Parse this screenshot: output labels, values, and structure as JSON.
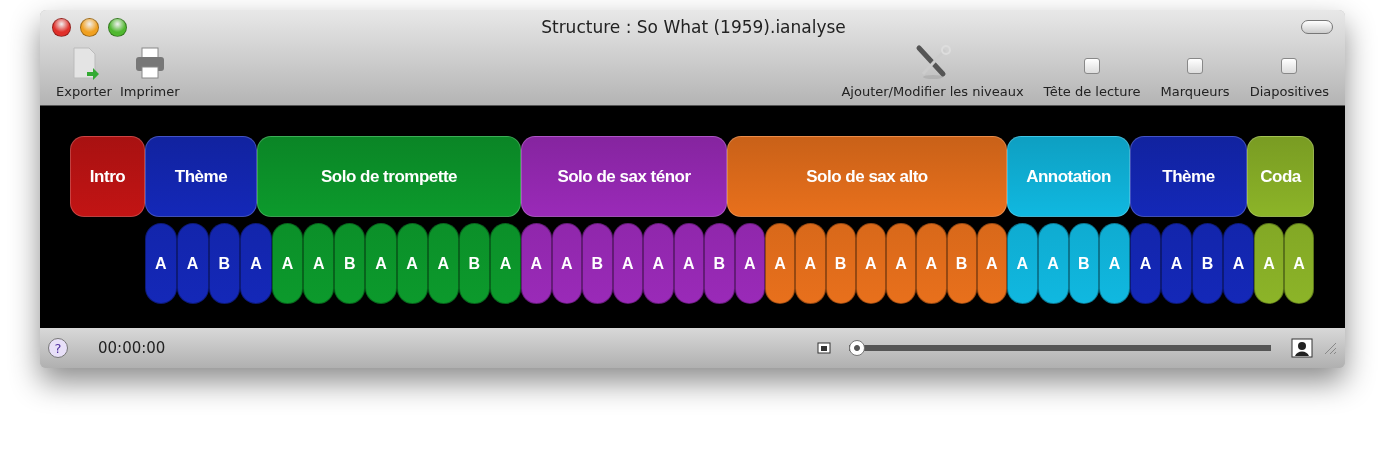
{
  "window": {
    "title": "Structure : So What (1959).ianalyse"
  },
  "toolbar": {
    "left": [
      {
        "label": "Exporter",
        "kind": "export"
      },
      {
        "label": "Imprimer",
        "kind": "print"
      }
    ],
    "tools": {
      "label": "Ajouter/Modifier les niveaux"
    },
    "toggles": [
      {
        "label": "Tête de lecture",
        "checked": false
      },
      {
        "label": "Marqueurs",
        "checked": false
      },
      {
        "label": "Diapositives",
        "checked": false
      }
    ]
  },
  "sections": [
    {
      "label": "Intro",
      "color": "#c21414"
    },
    {
      "label": "Thème",
      "color": "#1428b8"
    },
    {
      "label": "Solo de trompette",
      "color": "#0c9a2c"
    },
    {
      "label": "Solo de sax ténor",
      "color": "#9a2ab8"
    },
    {
      "label": "Solo de sax alto",
      "color": "#e8701c"
    },
    {
      "label": "Annotation",
      "color": "#10b8e0"
    },
    {
      "label": "Thème",
      "color": "#1428b8"
    },
    {
      "label": "Coda",
      "color": "#8cb428"
    }
  ],
  "subsections": [
    {
      "color": "#1428b8",
      "labels": [
        "A",
        "A",
        "B",
        "A"
      ]
    },
    {
      "color": "#0c9a2c",
      "labels": [
        "A",
        "A",
        "B",
        "A",
        "A",
        "A",
        "B",
        "A"
      ]
    },
    {
      "color": "#9a2ab8",
      "labels": [
        "A",
        "A",
        "B",
        "A",
        "A",
        "A",
        "B",
        "A"
      ]
    },
    {
      "color": "#e8701c",
      "labels": [
        "A",
        "A",
        "B",
        "A",
        "A",
        "A",
        "B",
        "A"
      ]
    },
    {
      "color": "#10b8e0",
      "labels": [
        "A",
        "A",
        "B",
        "A"
      ]
    },
    {
      "color": "#1428b8",
      "labels": [
        "A",
        "A",
        "B",
        "A"
      ]
    },
    {
      "color": "#8cb428",
      "labels": [
        "A",
        "A"
      ]
    }
  ],
  "status_bar": {
    "help": "?",
    "time": "00:00:00",
    "zoom": {
      "level": 0
    }
  }
}
